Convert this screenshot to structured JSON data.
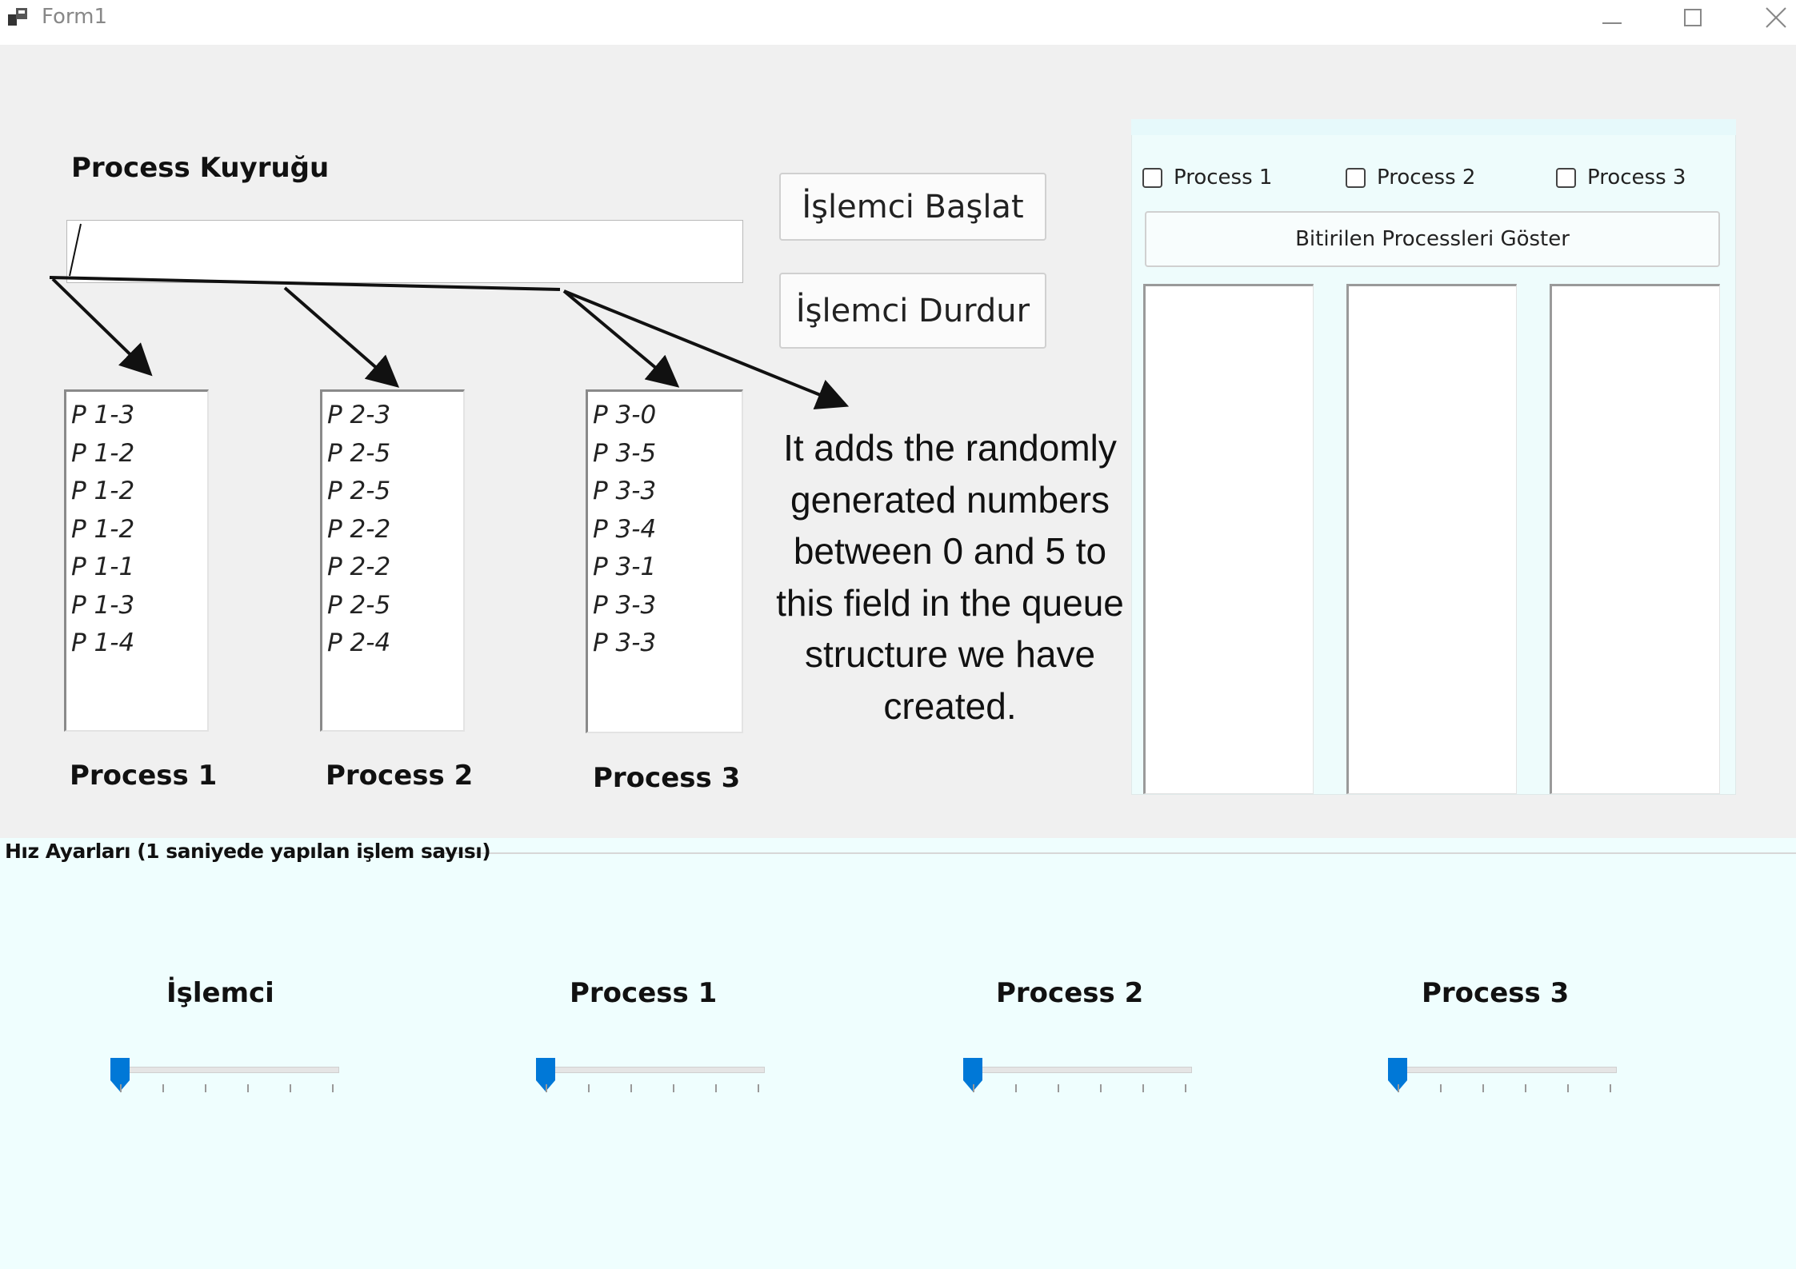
{
  "window": {
    "title": "Form1"
  },
  "queue": {
    "label": "Process Kuyruğu",
    "value": ""
  },
  "buttons": {
    "start": "İşlemci Başlat",
    "stop": "İşlemci Durdur"
  },
  "processes": [
    {
      "label": "Process 1",
      "items": [
        "P 1-3",
        "P 1-2",
        "P 1-2",
        "P 1-2",
        "P 1-1",
        "P 1-3",
        "P 1-4"
      ]
    },
    {
      "label": "Process 2",
      "items": [
        "P 2-3",
        "P 2-5",
        "P 2-5",
        "P 2-2",
        "P 2-2",
        "P 2-5",
        "P 2-4"
      ]
    },
    {
      "label": "Process 3",
      "items": [
        "P 3-0",
        "P 3-5",
        "P 3-3",
        "P 3-4",
        "P 3-1",
        "P 3-3",
        "P 3-3"
      ]
    }
  ],
  "annotation": {
    "lines": [
      "It adds the randomly",
      "generated numbers",
      "between 0 and 5 to",
      "this field in the queue",
      "structure we have",
      "created."
    ]
  },
  "finished_panel": {
    "checkboxes": [
      {
        "label": "Process 1",
        "checked": false
      },
      {
        "label": "Process 2",
        "checked": false
      },
      {
        "label": "Process 3",
        "checked": false
      }
    ],
    "show_button": "Bitirilen Processleri Göster"
  },
  "speed": {
    "title": "Hız Ayarları (1 saniyede yapılan işlem sayısı)",
    "sliders": [
      {
        "label": "İşlemci",
        "value": 0
      },
      {
        "label": "Process 1",
        "value": 0
      },
      {
        "label": "Process 2",
        "value": 0
      },
      {
        "label": "Process 3",
        "value": 0
      }
    ]
  },
  "colors": {
    "accent": "#0078d7",
    "panel": "#effefe",
    "form": "#f0f0f0"
  }
}
